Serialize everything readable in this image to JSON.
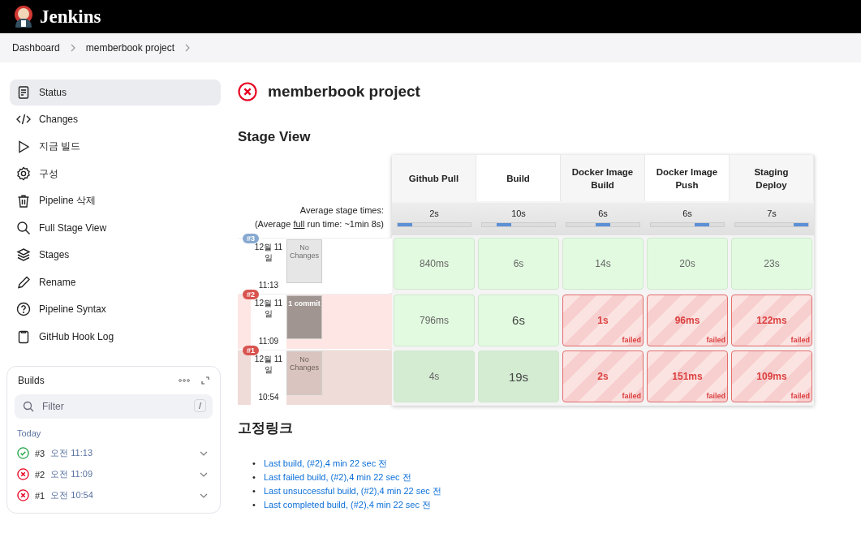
{
  "header": {
    "title": "Jenkins"
  },
  "breadcrumbs": [
    {
      "label": "Dashboard"
    },
    {
      "label": "memberbook project"
    }
  ],
  "sidebar": {
    "items": [
      {
        "label": "Status",
        "selected": true
      },
      {
        "label": "Changes",
        "selected": false
      },
      {
        "label": "지금 빌드",
        "selected": false
      },
      {
        "label": "구성",
        "selected": false
      },
      {
        "label": "Pipeline 삭제",
        "selected": false
      },
      {
        "label": "Full Stage View",
        "selected": false
      },
      {
        "label": "Stages",
        "selected": false
      },
      {
        "label": "Rename",
        "selected": false
      },
      {
        "label": "Pipeline Syntax",
        "selected": false
      },
      {
        "label": "GitHub Hook Log",
        "selected": false
      }
    ]
  },
  "builds_panel": {
    "title": "Builds",
    "filter": {
      "placeholder": "Filter",
      "shortcut": "/"
    },
    "group": "Today",
    "builds": [
      {
        "number": "#3",
        "time": "오전 11:13",
        "failed": false
      },
      {
        "number": "#2",
        "time": "오전 11:09",
        "failed": true
      },
      {
        "number": "#1",
        "time": "오전 10:54",
        "failed": true
      }
    ]
  },
  "project": {
    "title": "memberbook project",
    "failed": true
  },
  "stage_view": {
    "title": "Stage View",
    "avg_label": "Average stage times:",
    "avg_run_prefix": "(Average ",
    "avg_run_link": "full",
    "avg_run_suffix": " run time: ~1min 8s)",
    "stages": [
      {
        "name": "Github Pull",
        "avg": "2s"
      },
      {
        "name": "Build",
        "avg": "10s"
      },
      {
        "name": "Docker Image Build",
        "avg": "6s"
      },
      {
        "name": "Docker Image Push",
        "avg": "6s"
      },
      {
        "name": "Staging Deploy",
        "avg": "7s"
      }
    ],
    "runs": [
      {
        "badge": "#3",
        "failed": false,
        "date": "12월 11일",
        "time": "11:13",
        "changes": "No Changes",
        "has_changes": false,
        "cells": [
          {
            "duration": "840ms",
            "failed": false
          },
          {
            "duration": "6s",
            "failed": false
          },
          {
            "duration": "14s",
            "failed": false
          },
          {
            "duration": "20s",
            "failed": false
          },
          {
            "duration": "23s",
            "failed": false
          }
        ]
      },
      {
        "badge": "#2",
        "failed": true,
        "date": "12월 11일",
        "time": "11:09",
        "changes": "1 commit",
        "has_changes": true,
        "cells": [
          {
            "duration": "796ms",
            "failed": false
          },
          {
            "duration": "6s",
            "failed": false
          },
          {
            "duration": "1s",
            "failed": true,
            "note": "failed"
          },
          {
            "duration": "96ms",
            "failed": true,
            "note": "failed"
          },
          {
            "duration": "122ms",
            "failed": true,
            "note": "failed"
          }
        ]
      },
      {
        "badge": "#1",
        "failed": true,
        "date": "12월 11일",
        "time": "10:54",
        "changes": "No Changes",
        "has_changes": false,
        "cells": [
          {
            "duration": "4s",
            "failed": false
          },
          {
            "duration": "19s",
            "failed": false
          },
          {
            "duration": "2s",
            "failed": true,
            "note": "failed"
          },
          {
            "duration": "151ms",
            "failed": true,
            "note": "failed"
          },
          {
            "duration": "109ms",
            "failed": true,
            "note": "failed"
          }
        ]
      }
    ]
  },
  "permalinks": {
    "title": "고정링크",
    "links": [
      {
        "bullet": "•",
        "label": "Last build, (#2),4 min 22 sec 전"
      },
      {
        "bullet": "•",
        "label": "Last failed build, (#2),4 min 22 sec 전"
      },
      {
        "bullet": "•",
        "label": "Last unsuccessful build, (#2),4 min 22 sec 전"
      },
      {
        "bullet": "•",
        "label": "Last completed build, (#2),4 min 22 sec 전"
      }
    ]
  }
}
